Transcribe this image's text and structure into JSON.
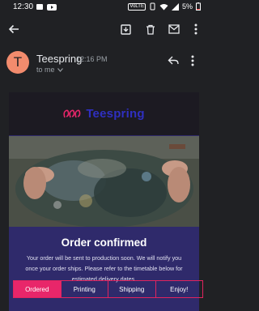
{
  "status_bar": {
    "time": "12:30",
    "network": "VoLTE",
    "battery": "5%"
  },
  "message": {
    "sender_initial": "T",
    "sender_name": "Teespring",
    "time": "12:16 PM",
    "recipient": "to me"
  },
  "email": {
    "brand": "Teespring",
    "title": "Order confirmed",
    "body": "Your order will be sent to production soon. We will notify you once your order ships. Please refer to the timetable below for estimated delivery dates.",
    "steps": [
      {
        "label": "Ordered",
        "active": true
      },
      {
        "label": "Printing",
        "active": false
      },
      {
        "label": "Shipping",
        "active": false
      },
      {
        "label": "Enjoy!",
        "active": false
      }
    ]
  },
  "colors": {
    "background": "#202124",
    "avatar": "#f28b6d",
    "card": "#2f2a6b",
    "accent_pink": "#e8266a",
    "logo_blue": "#2f2fc0"
  }
}
